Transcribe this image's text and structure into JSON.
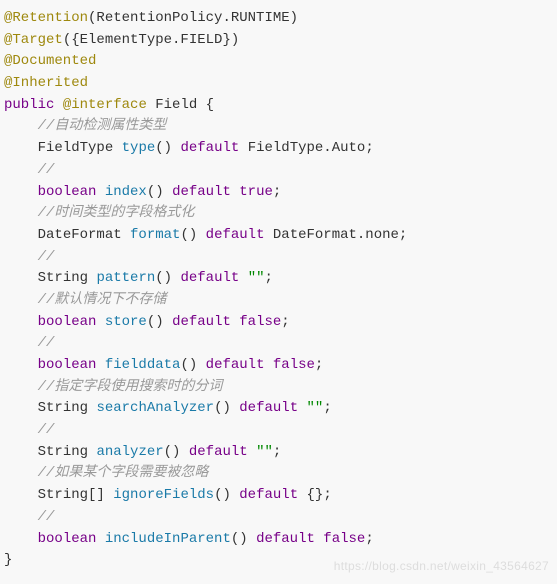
{
  "annotations": {
    "retention": "@Retention",
    "retention_arg": "(RetentionPolicy.RUNTIME)",
    "target": "@Target",
    "target_arg": "({ElementType.FIELD})",
    "documented": "@Documented",
    "inherited": "@Inherited"
  },
  "decl": {
    "public": "public",
    "atinterface": "@interface",
    "name": "Field",
    "open": " {",
    "close": "}"
  },
  "members": [
    {
      "comment": "//自动检测属性类型",
      "ret": "FieldType",
      "name": "type",
      "parens": "()",
      "def": "default",
      "val": "FieldType.Auto",
      "valClass": "plain"
    },
    {
      "comment": "//",
      "ret": "boolean",
      "retClass": "kw-purple",
      "name": "index",
      "parens": "()",
      "def": "default",
      "val": "true",
      "valClass": "bool-lit"
    },
    {
      "comment": "//时间类型的字段格式化",
      "ret": "DateFormat",
      "name": "format",
      "parens": "()",
      "def": "default",
      "val": "DateFormat.none",
      "valClass": "plain"
    },
    {
      "comment": "//",
      "ret": "String",
      "name": "pattern",
      "parens": "()",
      "def": "default",
      "val": "\"\"",
      "valClass": "str-lit"
    },
    {
      "comment": "//默认情况下不存储",
      "ret": "boolean",
      "retClass": "kw-purple",
      "name": "store",
      "parens": "()",
      "def": "default",
      "val": "false",
      "valClass": "bool-lit"
    },
    {
      "comment": "//",
      "ret": "boolean",
      "retClass": "kw-purple",
      "name": "fielddata",
      "parens": "()",
      "def": "default",
      "val": "false",
      "valClass": "bool-lit"
    },
    {
      "comment": "//指定字段使用搜索时的分词",
      "ret": "String",
      "name": "searchAnalyzer",
      "parens": "()",
      "def": "default",
      "val": "\"\"",
      "valClass": "str-lit"
    },
    {
      "comment": "//",
      "ret": "String",
      "name": "analyzer",
      "parens": "()",
      "def": "default",
      "val": "\"\"",
      "valClass": "str-lit"
    },
    {
      "comment": "//如果某个字段需要被忽略",
      "ret": "String[]",
      "name": "ignoreFields",
      "parens": "()",
      "def": "default",
      "val": "{}",
      "valClass": "plain"
    },
    {
      "comment": "//",
      "ret": "boolean",
      "retClass": "kw-purple",
      "name": "includeInParent",
      "parens": "()",
      "def": "default",
      "val": "false",
      "valClass": "bool-lit"
    }
  ],
  "watermark": "https://blog.csdn.net/weixin_43564627"
}
